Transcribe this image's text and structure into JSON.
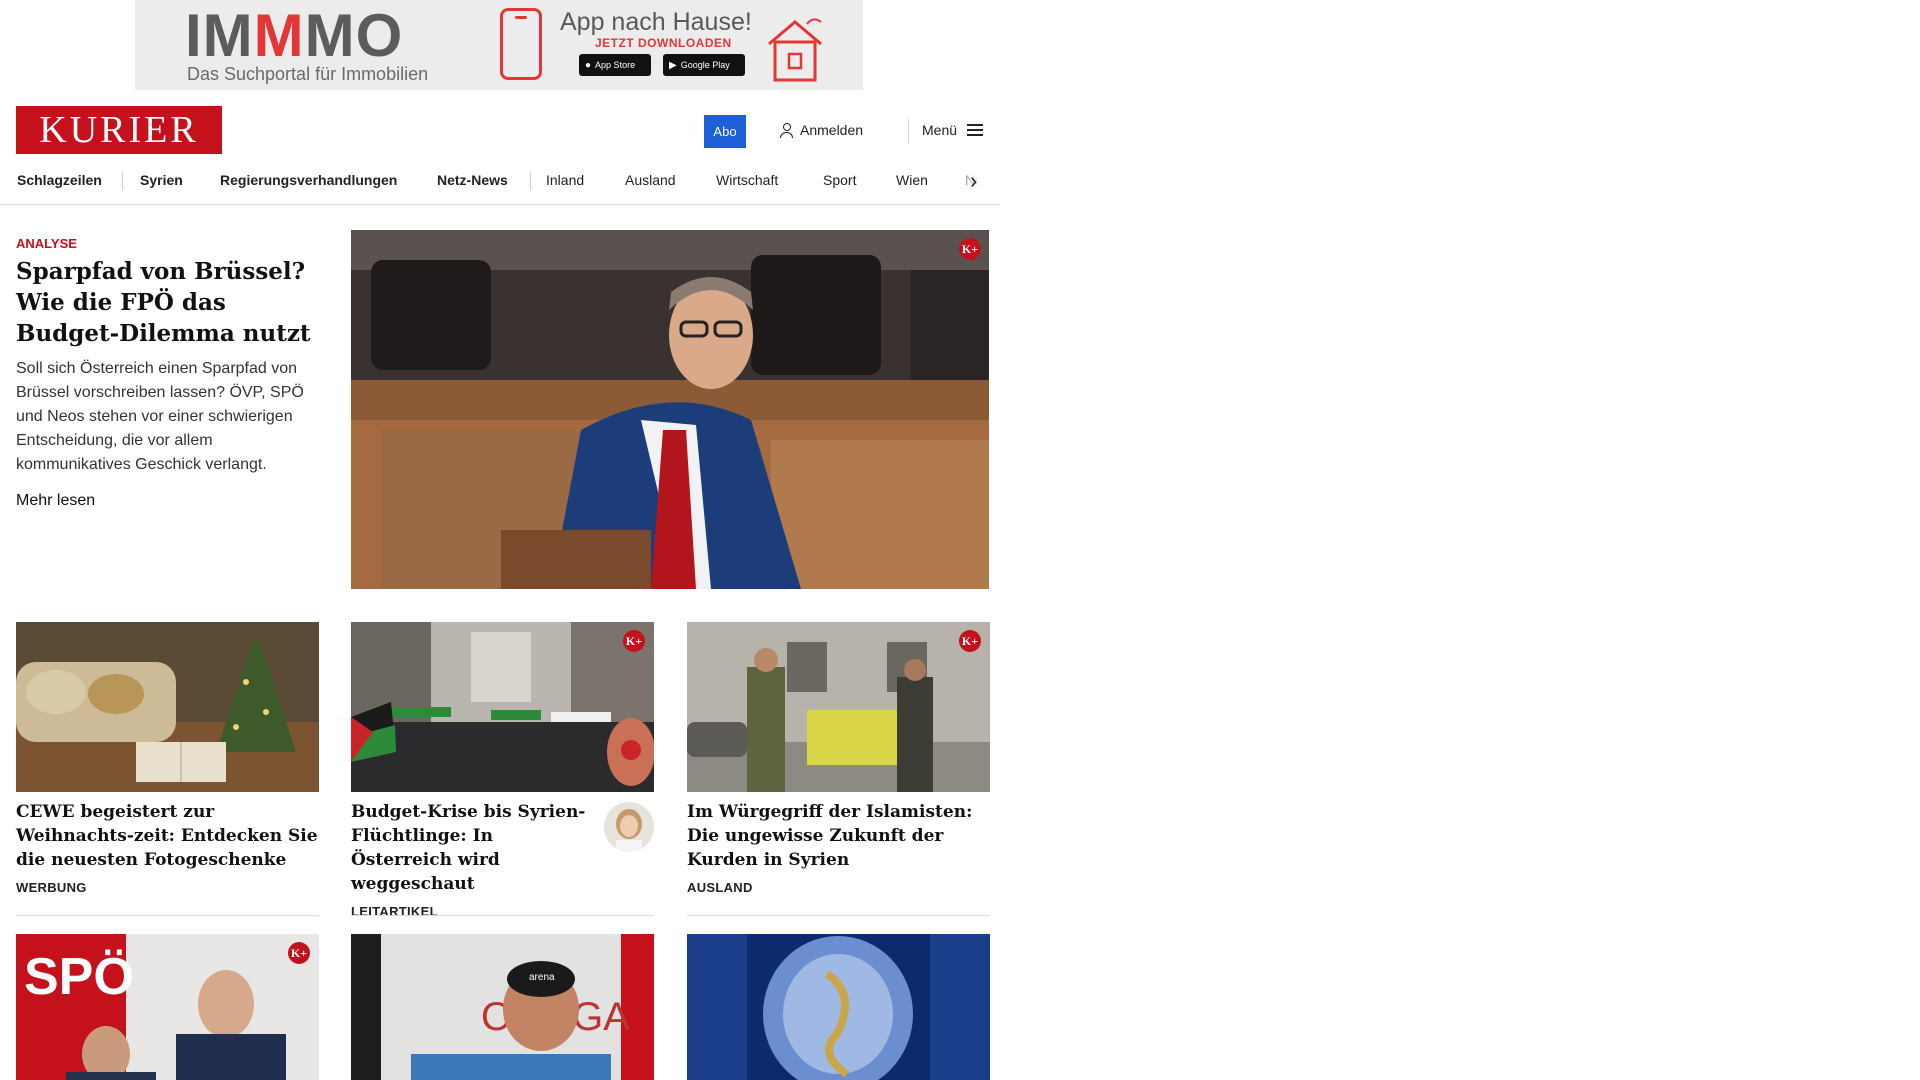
{
  "ad": {
    "logo_a": "IM",
    "logo_b": "M",
    "logo_c": "MO",
    "tagline": "Das Suchportal für Immobilien",
    "headline": "App nach Hause!",
    "cta": "JETZT DOWNLOADEN",
    "app_store": "App Store",
    "google_play": "Google Play",
    "brand_color": "#e33737"
  },
  "header": {
    "logo": "KURIER",
    "abo": "Abo",
    "login": "Anmelden",
    "menu": "Menü",
    "brand_color": "#c4111b",
    "abo_color": "#1d5fd6"
  },
  "nav": {
    "items": [
      "Schlagzeilen",
      "Syrien",
      "Regierungsverhandlungen",
      "Netz-News",
      "Inland",
      "Ausland",
      "Wirtschaft",
      "Sport",
      "Wien",
      "Ne"
    ]
  },
  "lead": {
    "kicker": "ANALYSE",
    "title": "Sparpfad von Brüssel? Wie die FPÖ das Budget-Dilemma nutzt",
    "teaser": "Soll sich Österreich einen Sparpfad von Brüssel vorschreiben lassen? ÖVP, SPÖ und Neos stehen vor einer schwierigen Entscheidung, die vor allem kommunikatives Geschick verlangt.",
    "more": "Mehr lesen",
    "badge": "K+"
  },
  "cards": [
    {
      "title": "CEWE begeistert zur Weihnachts-zeit: Entdecken Sie die neuesten Fotogeschenke",
      "category": "WERBUNG"
    },
    {
      "title": "Budget-Krise bis Syrien-Flüchtlinge: In Österreich wird weggeschaut",
      "category": "LEITARTIKEL",
      "badge": "K+"
    },
    {
      "title": "Im Würgegriff der Islamisten: Die ungewisse Zukunft der Kurden in Syrien",
      "category": "AUSLAND",
      "badge": "K+"
    }
  ],
  "bottom": {
    "badge": "K+",
    "spo_text": "SPÖ",
    "omega_text": "OMEGA",
    "arena_text": "arena"
  },
  "icons": [
    "user-icon",
    "hamburger-icon",
    "chevron-right-icon",
    "apple-icon",
    "play-icon",
    "phone-icon",
    "house-icon"
  ]
}
